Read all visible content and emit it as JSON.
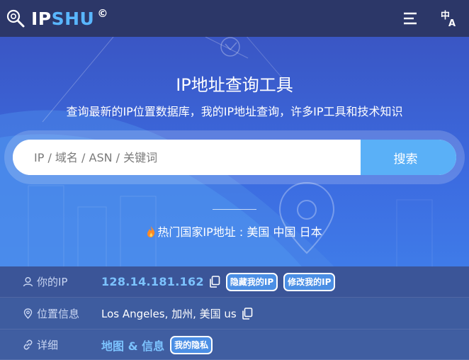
{
  "header": {
    "logo_ip": "IP",
    "logo_shu": "SHU",
    "logo_mark": "©",
    "menu_icon": "hamburger-menu-icon",
    "lang_icon": "translate-icon"
  },
  "hero": {
    "title": "IP地址查询工具",
    "subtitle": "查询最新的IP位置数据库，我的IP地址查询，许多IP工具和技术知识",
    "search": {
      "placeholder": "IP / 域名 / ASN / 关键词",
      "value": "",
      "button_label": "搜索"
    },
    "hot": {
      "label": "热门国家IP地址 : ",
      "countries": [
        "美国",
        "中国",
        "日本"
      ]
    }
  },
  "info": {
    "rows": [
      {
        "label": "你的IP",
        "icon": "user-icon",
        "value": "128.14.181.162",
        "actions": [
          "隐藏我的IP",
          "修改我的IP"
        ]
      },
      {
        "label": "位置信息",
        "icon": "location-pin-icon",
        "value": "Los Angeles, 加州, 美国 us"
      },
      {
        "label": "详细",
        "icon": "link-icon",
        "value": "地图 & 信息",
        "actions": [
          "我的隐私"
        ]
      }
    ]
  },
  "colors": {
    "header_bg": "#2c3768",
    "hero_bg": "#3c6be0",
    "accent": "#5ab0f7",
    "info_bg": "#3d5a9e",
    "link": "#7cc3ff"
  }
}
